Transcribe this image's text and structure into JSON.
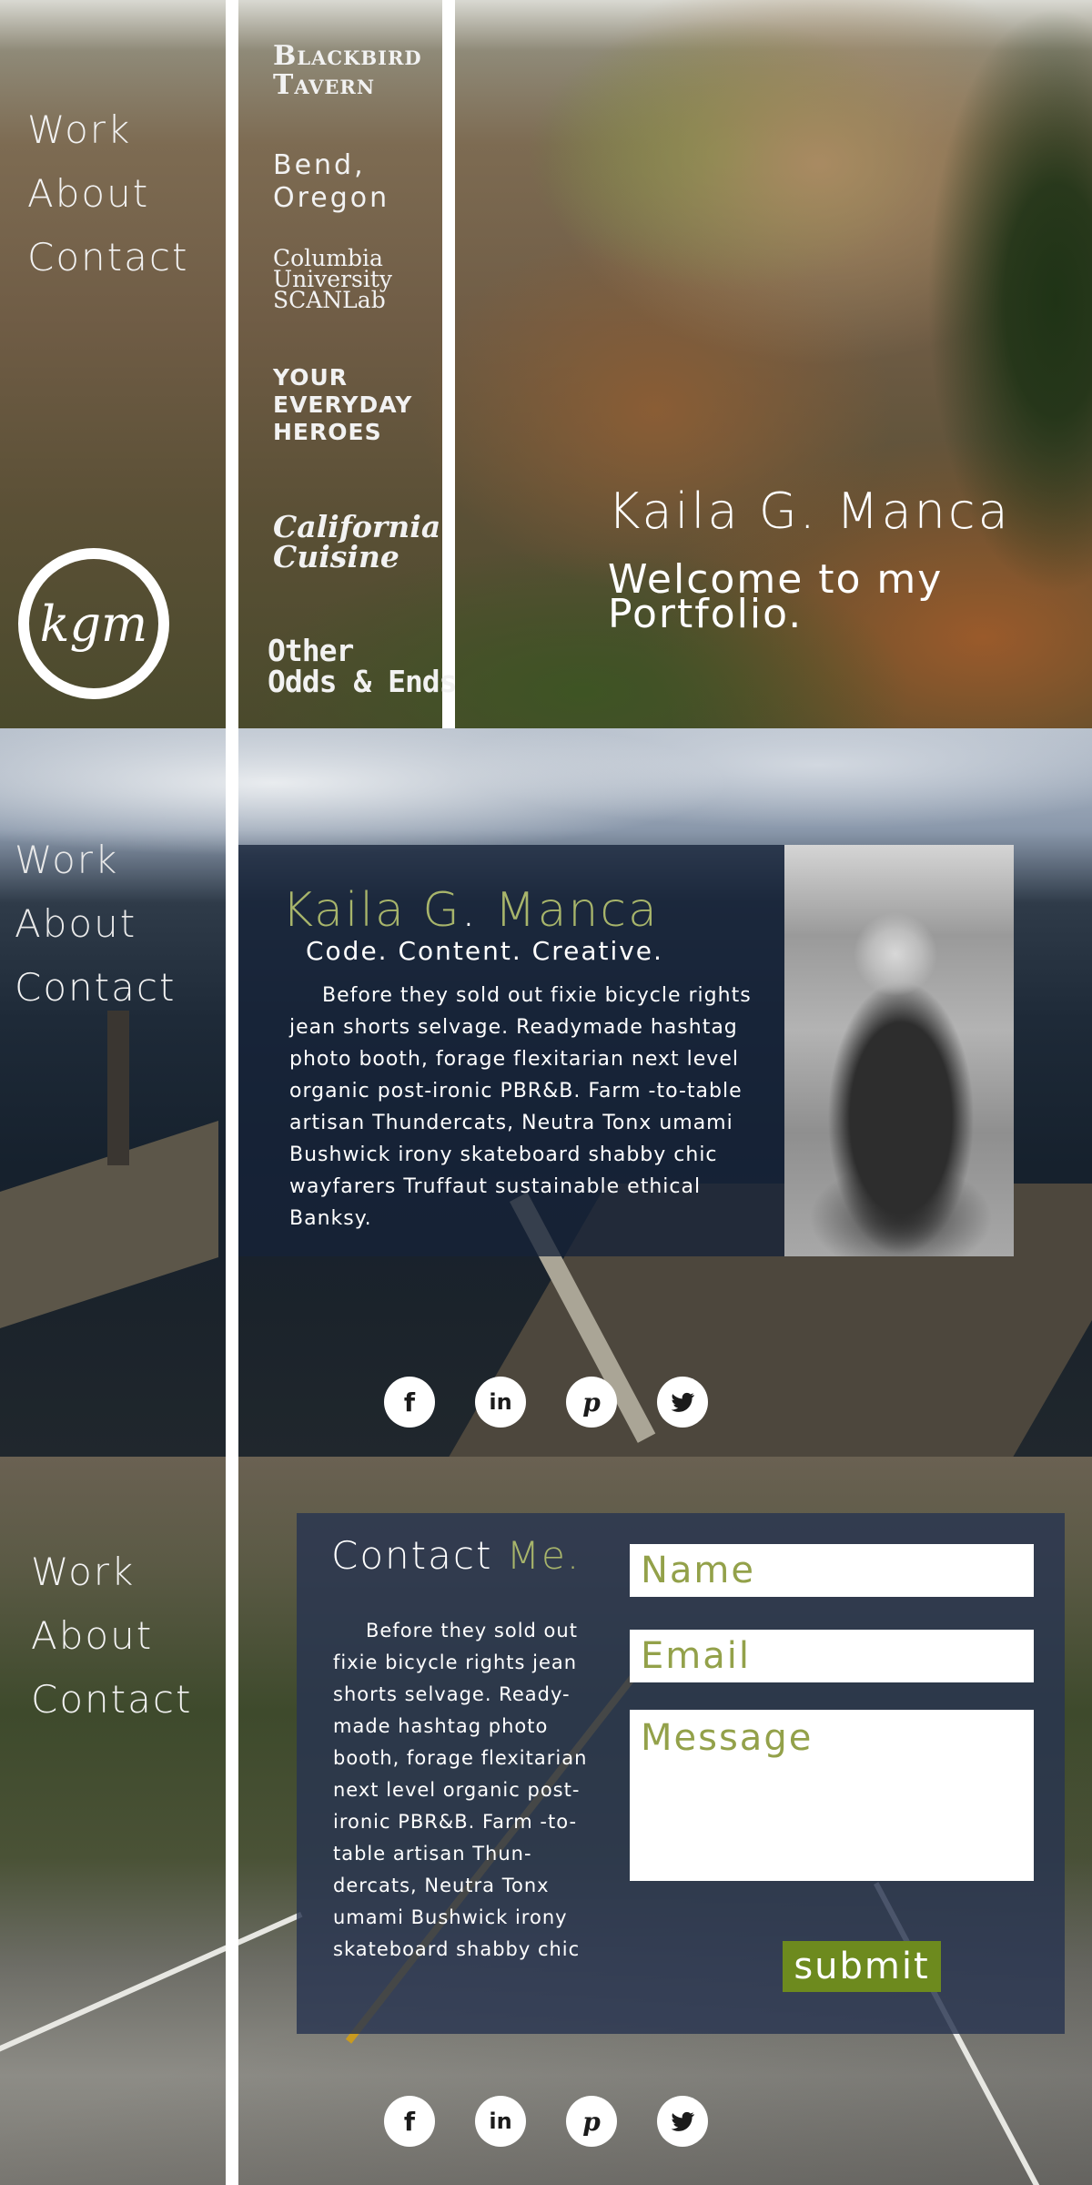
{
  "nav": {
    "items": [
      "Work",
      "About",
      "Contact"
    ]
  },
  "logo": {
    "monogram": "kgm"
  },
  "clients": {
    "blackbird": [
      "Blackbird",
      "Tavern"
    ],
    "bend": [
      "Bend,",
      "Oregon"
    ],
    "columbia": [
      "Columbia",
      "University",
      "SCANLab"
    ],
    "heroes": [
      "YOUR",
      "EVERYDAY",
      "HEROES"
    ],
    "california": [
      "California",
      "Cuisine"
    ],
    "other": [
      "Other",
      "Odds & Ends"
    ]
  },
  "hero": {
    "name": "Kaila G. Manca",
    "welcome": "Welcome to my Portfolio."
  },
  "about": {
    "name_first": "Kaila G",
    "name_dot": ".",
    "name_last": " Manca",
    "tagline": "Code. Content. Creative.",
    "body": "Before they sold out fixie bicycle rights jean shorts selvage. Readymade hashtag photo booth, forage flexitarian next level organic post-ironic PBR&B. Farm -to-table artisan Thundercats, Neutra Tonx umami Bushwick irony skateboard shabby chic wayfarers Truffaut sustainable ethical Banksy."
  },
  "social": {
    "facebook": "f",
    "linkedin": "in",
    "pinterest": "p"
  },
  "contact": {
    "title_word1": "Contact",
    "title_word2": "Me.",
    "body": "Before they sold out fixie bicycle rights jean shorts selvage. Ready-made hashtag photo booth, forage flexitarian next level organic post-ironic PBR&B. Farm -to-table artisan Thun-dercats, Neutra Tonx umami Bushwick irony skateboard shabby chic",
    "name_placeholder": "Name",
    "email_placeholder": "Email",
    "message_placeholder": "Message",
    "submit_label": "submit"
  },
  "colors": {
    "accent_green": "#a8b56b",
    "submit_green": "#6d8a1e",
    "panel_navy": "#162238"
  }
}
